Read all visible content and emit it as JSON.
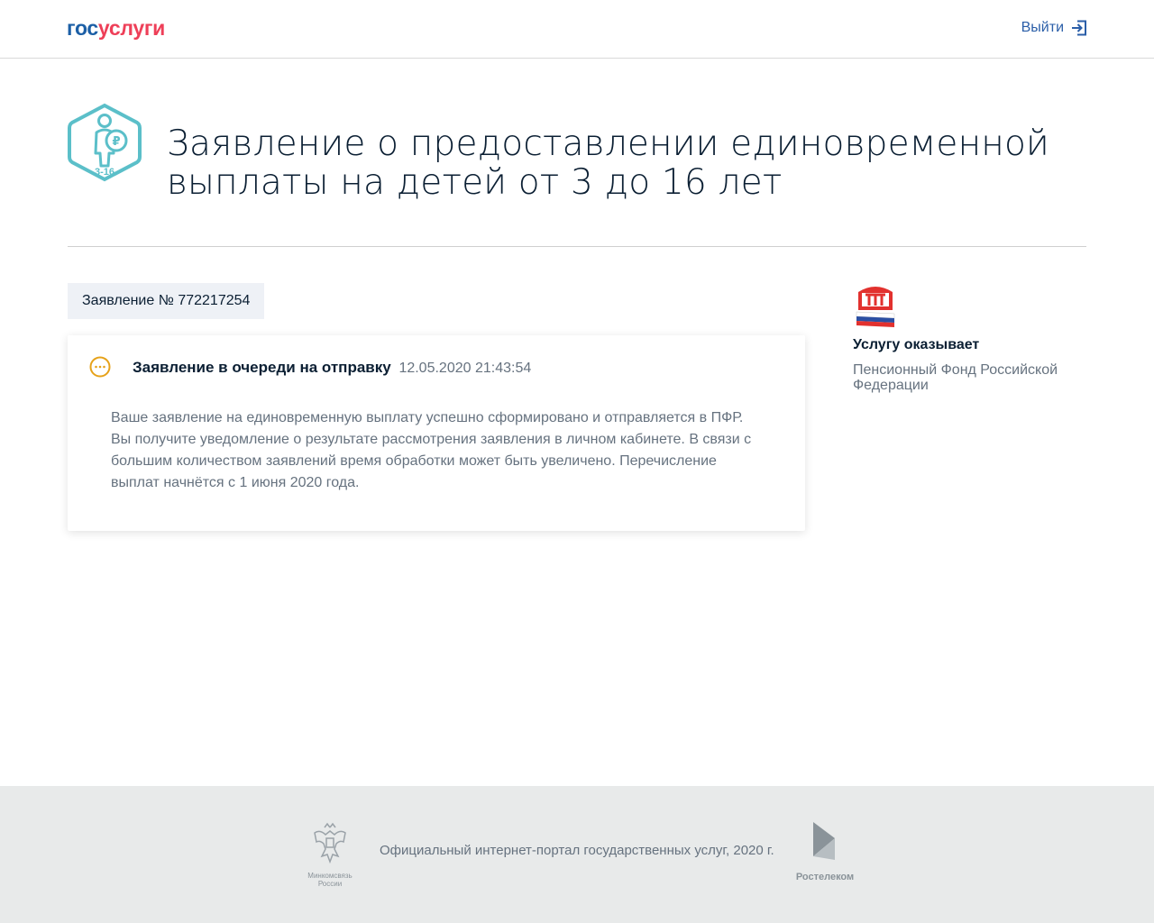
{
  "header": {
    "logo_part1": "гос",
    "logo_part2": "услуги",
    "logout_label": "Выйти"
  },
  "service": {
    "icon_badge": "3-16",
    "title": "Заявление о предоставлении единовременной выплаты на детей от 3 до 16 лет"
  },
  "application": {
    "number_label": "Заявление № 772217254"
  },
  "status_card": {
    "status": "Заявление в очереди на отправку",
    "datetime": "12.05.2020 21:43:54",
    "message": "Ваше заявление на единовременную выплату успешно сформировано и отправляется в ПФР. Вы получите уведомление о результате рассмотрения заявления в личном кабинете. В связи с большим количеством заявлений время обработки может быть увеличено. Перечисление выплат начнётся с 1 июня 2020 года."
  },
  "provider": {
    "label": "Услугу оказывает",
    "name": "Пенсионный Фонд Российской Федерации"
  },
  "footer": {
    "ministry_caption": "Минкомсвязь России",
    "text": "Официальный интернет-портал государственных услуг, 2020 г.",
    "operator_caption": "Ростелеком"
  },
  "colors": {
    "brand_blue": "#1c5fa6",
    "brand_red": "#ee3f58",
    "status_orange": "#e6a21a",
    "icon_teal": "#5bbfc9"
  }
}
